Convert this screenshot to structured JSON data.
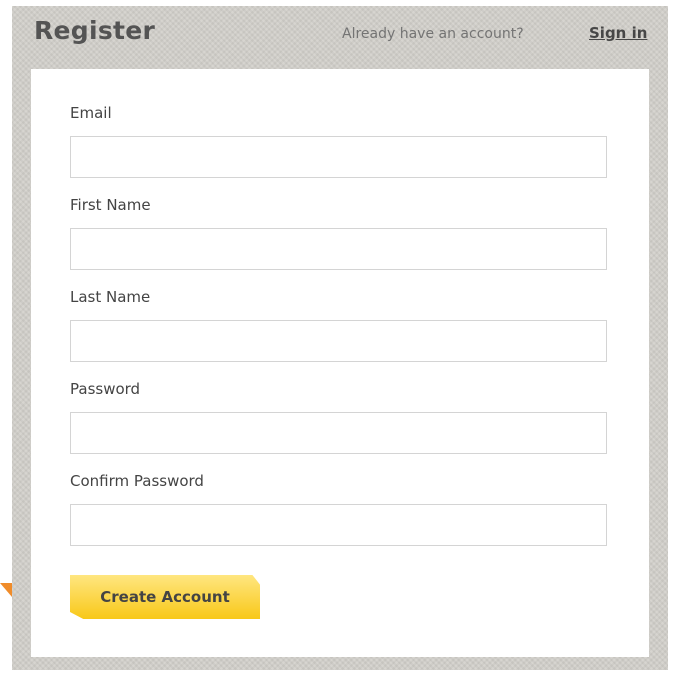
{
  "header": {
    "title": "Register",
    "account_prompt": "Already have an account?",
    "sign_in_label": "Sign in"
  },
  "form": {
    "fields": [
      {
        "label": "Email",
        "value": ""
      },
      {
        "label": "First Name",
        "value": ""
      },
      {
        "label": "Last Name",
        "value": ""
      },
      {
        "label": "Password",
        "value": ""
      },
      {
        "label": "Confirm Password",
        "value": ""
      }
    ],
    "submit_label": "Create Account"
  },
  "colors": {
    "panel_background": "#d3d1cb",
    "card_background": "#ffffff",
    "button_gradient_top": "#ffe680",
    "button_gradient_bottom": "#f8c818",
    "pointer_arrow": "#f08c2a"
  }
}
